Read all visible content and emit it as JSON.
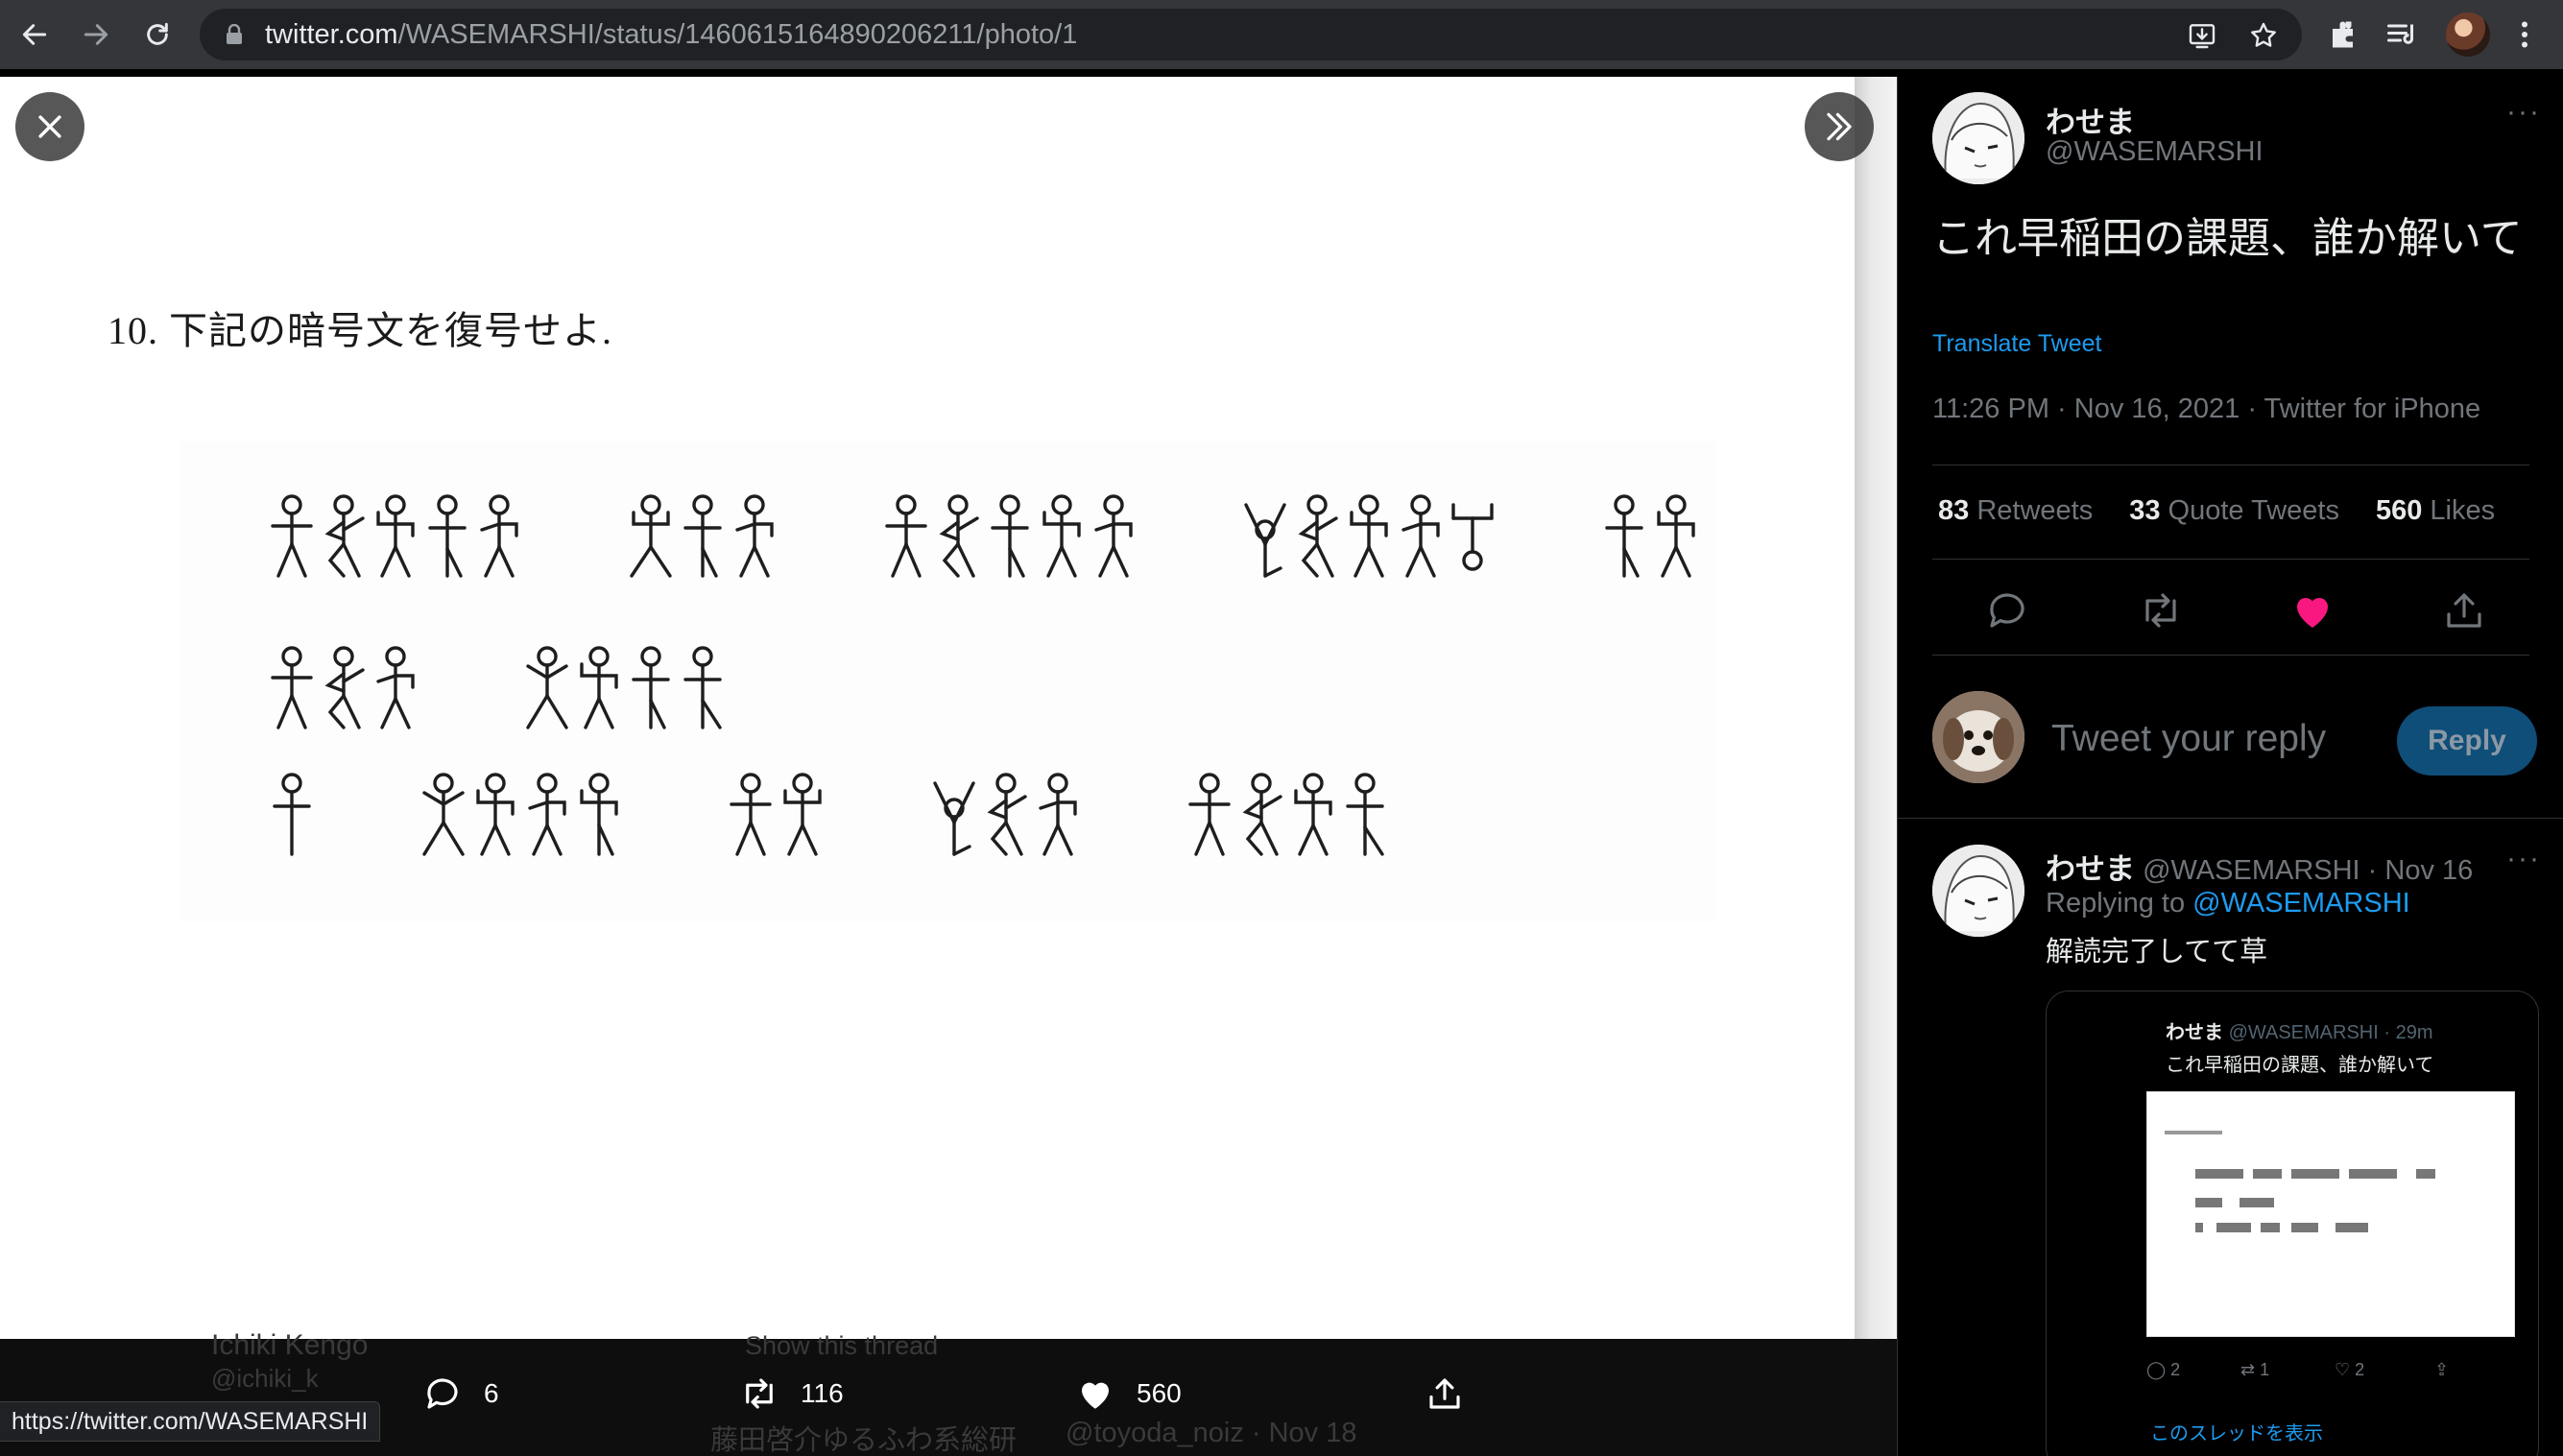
{
  "browser": {
    "url_host": "twitter.com",
    "url_path": "/WASEMARSHI/status/1460615164890206211/photo/1",
    "status_url": "https://twitter.com/WASEMARSHI"
  },
  "photo": {
    "question": "10.  下記の暗号文を復号せよ."
  },
  "actions": {
    "replies": "6",
    "retweets": "116",
    "likes": "560"
  },
  "ghost_text": {
    "name1": "Ichiki Kengo",
    "handle1": "@ichiki_k",
    "show_thread": "Show this thread",
    "name2": "藤田啓介ゆるふわ系総研",
    "handle2": "@toyoda_noiz · Nov 18"
  },
  "tweet": {
    "name": "わせま",
    "handle": "@WASEMARSHI",
    "more": "···",
    "text": "これ早稲田の課題、誰か解いて",
    "translate": "Translate Tweet",
    "meta": "11:26 PM · Nov 16, 2021 · Twitter for iPhone",
    "retweets_count": "83",
    "retweets_label": "Retweets",
    "quotes_count": "33",
    "quotes_label": "Quote Tweets",
    "likes_count": "560",
    "likes_label": "Likes"
  },
  "reply_box": {
    "placeholder": "Tweet your reply",
    "button": "Reply"
  },
  "reply": {
    "name": "わせま",
    "handle_time": "@WASEMARSHI · Nov 16",
    "more": "···",
    "replying_to_label": "Replying to",
    "replying_to_handle": "@WASEMARSHI",
    "text": "解読完了してて草",
    "quoted": {
      "name": "わせま",
      "handle_time": "@WASEMARSHI · 29m",
      "text": "これ早稲田の課題、誰か解いて",
      "replies": "2",
      "retweets": "1",
      "likes": "2",
      "show_thread": "このスレッドを表示"
    }
  },
  "colors": {
    "like_active": "#f91880",
    "link": "#1d9bf0",
    "chrome_bar": "#35363a"
  }
}
